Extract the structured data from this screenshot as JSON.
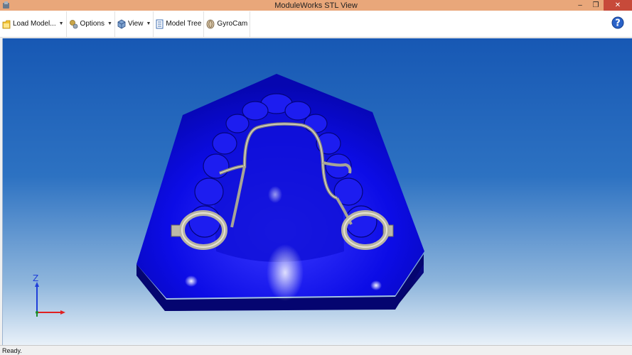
{
  "window": {
    "title": "ModuleWorks STL View",
    "controls": [
      "minimize",
      "restore",
      "close"
    ]
  },
  "toolbar": {
    "items": [
      {
        "label": "Load Model...",
        "icon": "folder-icon",
        "has_dropdown": true
      },
      {
        "label": "Options",
        "icon": "options-icon",
        "has_dropdown": true
      },
      {
        "label": "View",
        "icon": "view-cube-icon",
        "has_dropdown": true
      },
      {
        "label": "Model Tree",
        "icon": "model-tree-icon",
        "has_dropdown": false
      },
      {
        "label": "GyroCam",
        "icon": "gyrocam-icon",
        "has_dropdown": false
      }
    ],
    "help_icon": "help-icon"
  },
  "viewport": {
    "model": "dental-cast-with-retainer",
    "colors": {
      "cast": "#0b0bdf",
      "cast_side": "#05056a",
      "wire": "#b9b6a6",
      "bg_top": "#1758b4",
      "bg_bottom": "#e9f1f9"
    },
    "axis": {
      "z_label": "Z",
      "z_color": "#1f3fd9",
      "x_color": "#e02020"
    }
  },
  "status": {
    "text": "Ready."
  }
}
